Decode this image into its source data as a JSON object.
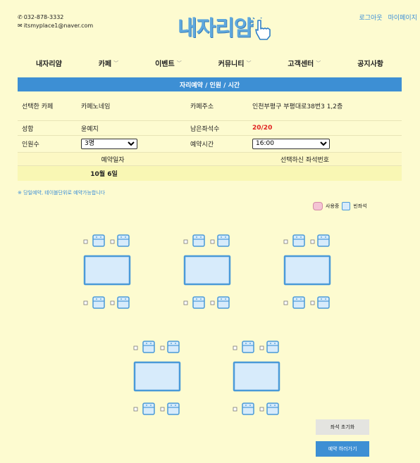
{
  "contact": {
    "phone": "032-878-3332",
    "email": "itsmyplace1@naver.com"
  },
  "logo": {
    "text": "내자리얌",
    "icon": "pointing-hand-icon"
  },
  "top_links": {
    "logout": "로그아웃",
    "mypage": "마이페이지"
  },
  "nav": [
    {
      "label": "내자리얌",
      "dropdown": false
    },
    {
      "label": "카페",
      "dropdown": true
    },
    {
      "label": "이벤트",
      "dropdown": true
    },
    {
      "label": "커뮤니티",
      "dropdown": true
    },
    {
      "label": "고객센터",
      "dropdown": true
    },
    {
      "label": "공지사항",
      "dropdown": false
    }
  ],
  "section_title": "자리예약 / 인원 / 시간",
  "info": {
    "cafe_label": "선택한 카페",
    "cafe_value": "카페노네임",
    "address_label": "카페주소",
    "address_value": "인천부평구 부평대로38번3 1,2층",
    "name_label": "성함",
    "name_value": "윤예지",
    "remaining_label": "남은좌석수",
    "remaining_value": "20/20",
    "people_label": "인원수",
    "people_value": "3명",
    "time_label": "예약시간",
    "time_value": "16:00"
  },
  "date_header": {
    "date_label": "예약일자",
    "seat_label": "선택하신 좌석번호"
  },
  "date_row": {
    "date_value": "10월 6일",
    "seat_value": ""
  },
  "notice": "※ 당일예약, 테이블단위로 예약가능합니다",
  "legend": {
    "occupied": "사용중",
    "empty": "빈좌석"
  },
  "buttons": {
    "reset": "좌석 초기화",
    "reserve": "예약 하러가기"
  },
  "colors": {
    "accent": "#3d8fd4",
    "background": "#fdfbd0",
    "seat_fill": "#d7ebfb",
    "seat_stroke": "#4a9ad8",
    "occupied": "#f4c4d4"
  }
}
